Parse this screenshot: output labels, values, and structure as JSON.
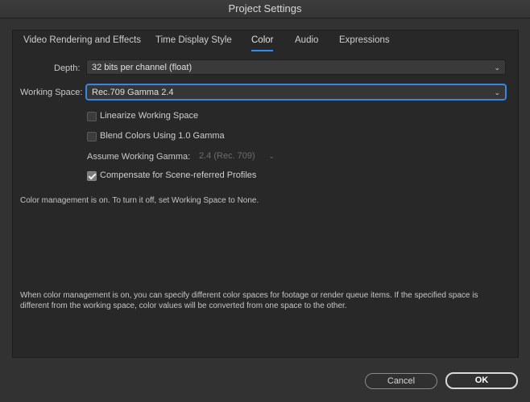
{
  "window": {
    "title": "Project Settings"
  },
  "tabs": [
    {
      "label": "Video Rendering and Effects"
    },
    {
      "label": "Time Display Style"
    },
    {
      "label": "Color"
    },
    {
      "label": "Audio"
    },
    {
      "label": "Expressions"
    }
  ],
  "active_tab": "Color",
  "accent_color": "#2e8ff0",
  "color": {
    "depth": {
      "label": "Depth:",
      "value": "32 bits per channel (float)"
    },
    "working_space": {
      "label": "Working Space:",
      "value": "Rec.709 Gamma 2.4"
    },
    "linearize": {
      "label": "Linearize Working Space",
      "checked": false
    },
    "blend_gamma": {
      "label": "Blend Colors Using 1.0 Gamma",
      "checked": false
    },
    "assume_gamma": {
      "label": "Assume Working Gamma:",
      "value": "2.4 (Rec. 709)",
      "enabled": false
    },
    "compensate": {
      "label": "Compensate for Scene-referred Profiles",
      "checked": true
    },
    "status_note": "Color management is on. To turn it off, set Working Space to None.",
    "info_note": "When color management is on, you can specify different color spaces for footage or render queue items. If the specified space is different from the working space, color values will be converted from one space to the other."
  },
  "buttons": {
    "cancel": "Cancel",
    "ok": "OK"
  }
}
